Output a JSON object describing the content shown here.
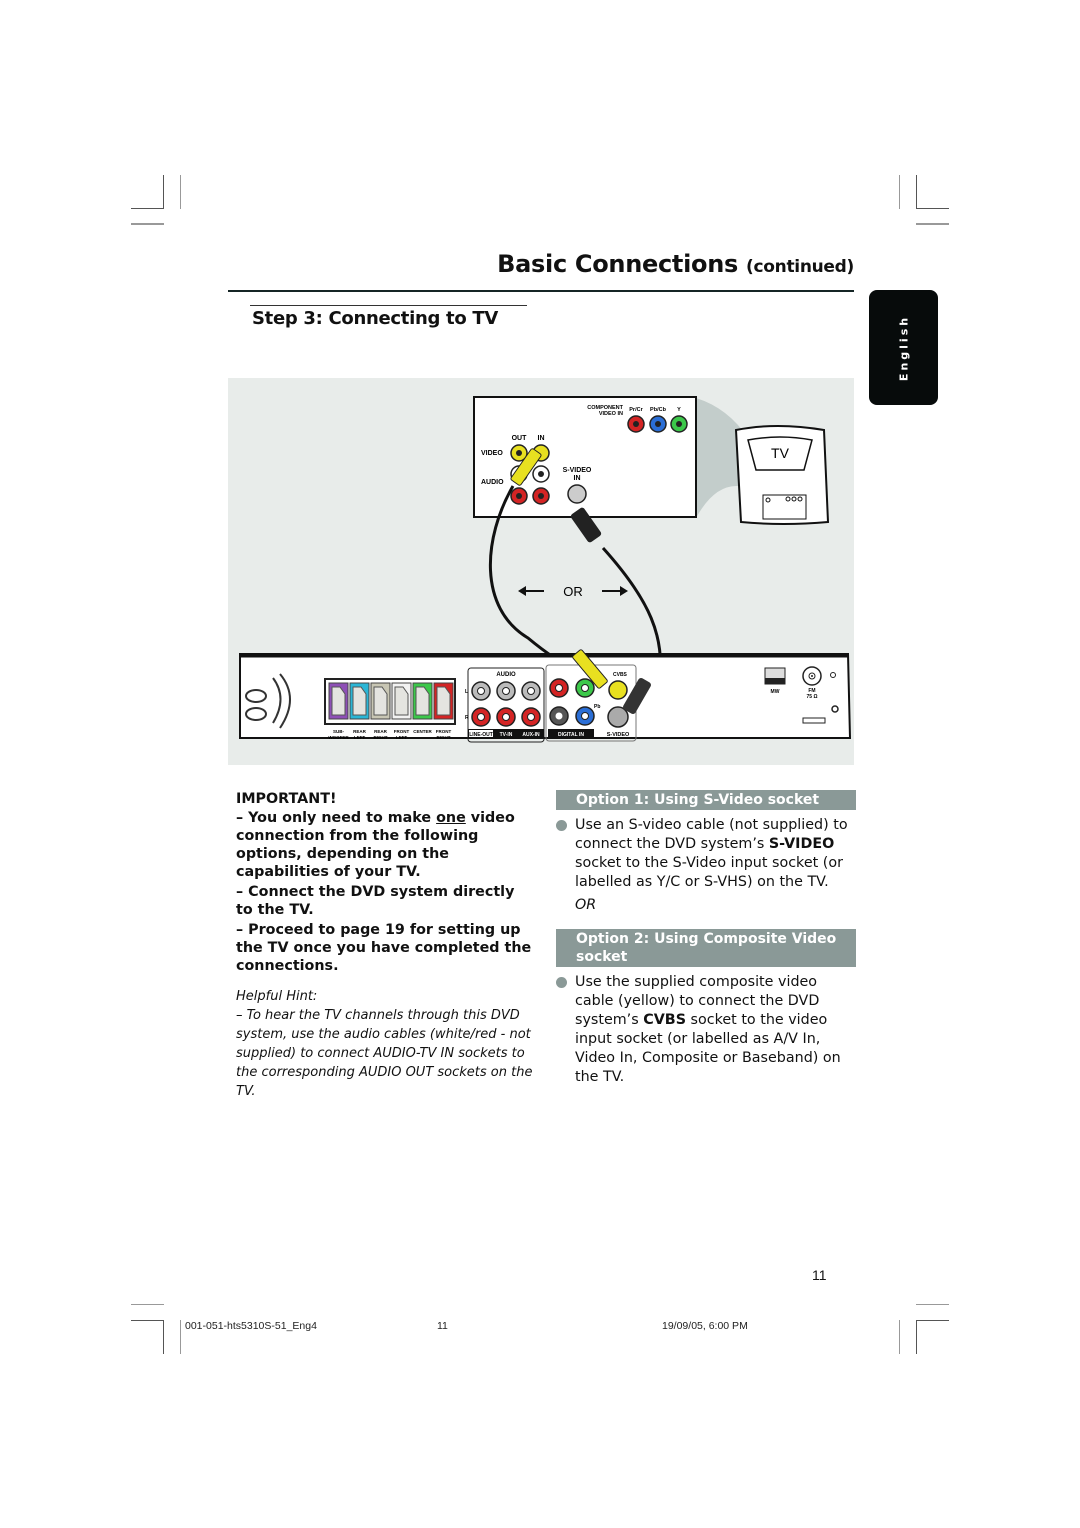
{
  "header": {
    "title": "Basic Connections",
    "title_suffix": "(continued)",
    "language_tab": "English"
  },
  "step": {
    "title": "Step 3:  Connecting to TV"
  },
  "illustration": {
    "tv_panel": {
      "component_label_1": "COMPONENT",
      "component_label_2": "VIDEO IN",
      "component_cols": [
        "Pr/Cr",
        "Pb/Cb",
        "Y"
      ],
      "out_label": "OUT",
      "in_label": "IN",
      "video_label": "VIDEO",
      "audio_label": "AUDIO",
      "svideo_label_1": "S-VIDEO",
      "svideo_label_2": "IN"
    },
    "tv_label": "TV",
    "or_label": "OR",
    "dvd_panel": {
      "speaker_labels": [
        [
          "SUB-",
          "WOOFER"
        ],
        [
          "REAR",
          "LEFT"
        ],
        [
          "REAR",
          "RIGHT"
        ],
        [
          "FRONT",
          "LEFT"
        ],
        [
          "CENTER",
          ""
        ],
        [
          "FRONT",
          "RIGHT"
        ]
      ],
      "speaker_colors": [
        "#8e4fb6",
        "#2ab6d6",
        "#c8c6b4",
        "#f2f2f2",
        "#3cc84a",
        "#d42424"
      ],
      "audio_label": "AUDIO",
      "l_label": "L",
      "r_label": "R",
      "line_out": "LINE-OUT",
      "tv_in": "TV-IN",
      "aux_in": "AUX-IN",
      "pr_label": "Pr",
      "pb_label": "Pb",
      "cvbs_label": "CVBS",
      "digital_in": "DIGITAL IN",
      "svideo": "S-VIDEO",
      "mw": "MW",
      "fm_1": "FM",
      "fm_2": "75 Ω"
    }
  },
  "important": {
    "heading": "IMPORTANT!",
    "item1_pre": "– You only need to make ",
    "item1_underline": "one",
    "item1_post": " video connection from the following options, depending on the capabilities of your TV.",
    "item2": "– Connect the DVD system directly to the TV.",
    "item3": "– Proceed to page 19 for setting up the TV once you have completed the connections."
  },
  "hint": {
    "heading": "Helpful Hint:",
    "text": "–  To hear the TV channels through this DVD system, use the audio cables (white/red - not supplied) to connect AUDIO-TV IN sockets to the corresponding AUDIO OUT sockets on the TV."
  },
  "option1": {
    "title": "Option 1: Using S-Video socket",
    "text_pre": "Use an S-video cable (not supplied) to connect the DVD system’s ",
    "text_bold": "S-VIDEO",
    "text_post": " socket to the S-Video input socket (or labelled as Y/C or S-VHS) on the TV."
  },
  "or_separator": "OR",
  "option2": {
    "title": "Option 2: Using Composite Video socket",
    "text_pre": "Use the supplied composite video cable (yellow) to connect the DVD system’s ",
    "text_bold": "CVBS",
    "text_post": " socket to the video input socket (or labelled as A/V In, Video In, Composite or Baseband) on the TV."
  },
  "footer": {
    "page_number": "11",
    "file_name": "001-051-hts5310S-51_Eng4",
    "file_page": "11",
    "timestamp": "19/09/05, 6:00 PM"
  }
}
